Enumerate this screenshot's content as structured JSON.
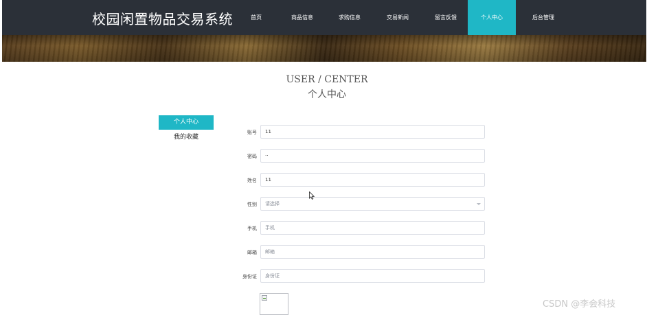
{
  "header": {
    "site_title": "校园闲置物品交易系统",
    "nav": [
      {
        "label": "首页"
      },
      {
        "label": "商品信息"
      },
      {
        "label": "求购信息"
      },
      {
        "label": "交易新闻"
      },
      {
        "label": "留言反馈"
      },
      {
        "label": "个人中心",
        "active": true
      },
      {
        "label": "后台管理"
      }
    ],
    "nav_bg": "#2b3038",
    "accent": "#1fb7c6"
  },
  "page_heading": {
    "en": "USER / CENTER",
    "cn": "个人中心"
  },
  "side_menu": [
    {
      "label": "个人中心",
      "active": true
    },
    {
      "label": "我的收藏"
    }
  ],
  "form": {
    "account": {
      "label": "账号",
      "value": "11"
    },
    "password": {
      "label": "密码",
      "value": "··"
    },
    "name": {
      "label": "姓名",
      "value": "11"
    },
    "gender": {
      "label": "性别",
      "placeholder": "请选择"
    },
    "phone": {
      "label": "手机",
      "placeholder": "手机"
    },
    "email": {
      "label": "邮箱",
      "placeholder": "邮箱"
    },
    "id_card": {
      "label": "身份证",
      "placeholder": "身份证"
    }
  },
  "icons": {
    "select": "chevron-down-icon",
    "image": "broken-image-icon",
    "cursor": "mouse-cursor-icon"
  },
  "watermark": "CSDN @李会科技"
}
